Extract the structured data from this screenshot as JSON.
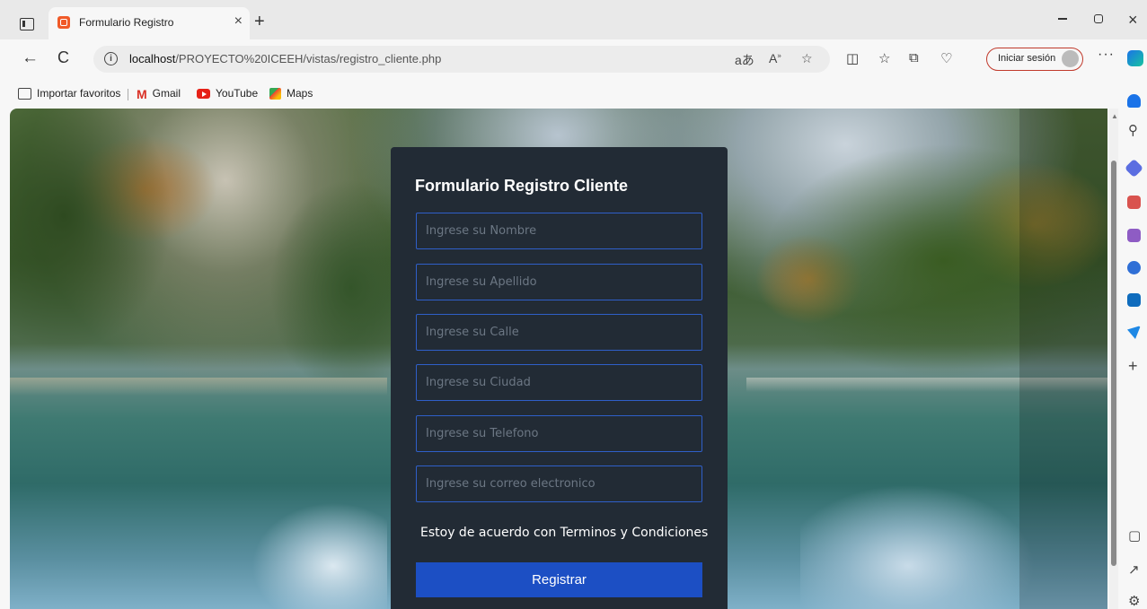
{
  "browser": {
    "tab": {
      "title": "Formulario Registro",
      "close": "×"
    },
    "new_tab": "+",
    "window": {
      "minimize": "—",
      "close": "×"
    },
    "nav": {
      "back": "←",
      "reload": "C"
    },
    "url_host": "localhost",
    "url_path": "/PROYECTO%20ICEEH/vistas/registro_cliente.php",
    "info_icon": "i",
    "signin_label": "Iniciar sesión",
    "more": "···",
    "favorites": [
      {
        "label": "Importar favoritos",
        "icon": "import-icon"
      },
      {
        "label": "Gmail",
        "icon": "gmail-icon"
      },
      {
        "label": "YouTube",
        "icon": "youtube-icon"
      },
      {
        "label": "Maps",
        "icon": "maps-icon"
      }
    ],
    "sidebar_add": "+"
  },
  "form": {
    "title": "Formulario Registro Cliente",
    "fields": [
      {
        "placeholder": "Ingrese su Nombre",
        "value": ""
      },
      {
        "placeholder": "Ingrese su Apellido",
        "value": ""
      },
      {
        "placeholder": "Ingrese su Calle",
        "value": ""
      },
      {
        "placeholder": "Ingrese su Ciudad",
        "value": ""
      },
      {
        "placeholder": "Ingrese su Telefono",
        "value": ""
      },
      {
        "placeholder": "Ingrese su correo electronico",
        "value": ""
      }
    ],
    "terms_label": "Estoy de acuerdo con Terminos y Condiciones",
    "submit_label": "Registrar"
  },
  "colors": {
    "card_bg": "#222b35",
    "field_border": "#2f5fc9",
    "submit_bg": "#1c4fc4",
    "signin_border": "#c0392b"
  }
}
